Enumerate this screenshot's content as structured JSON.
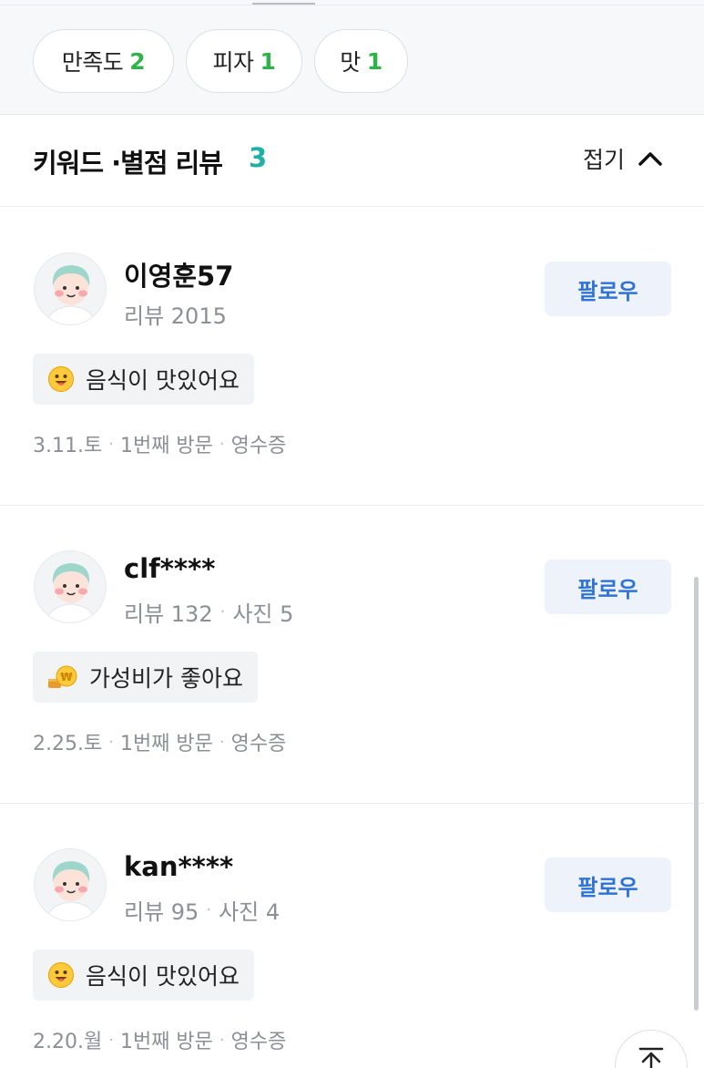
{
  "filters": [
    {
      "label": "만족도",
      "count": "2"
    },
    {
      "label": "피자",
      "count": "1"
    },
    {
      "label": "맛",
      "count": "1"
    }
  ],
  "section": {
    "title": "키워드 ·별점 리뷰",
    "count": "3",
    "collapse_label": "접기",
    "collapse_icon": "chevron-up-icon"
  },
  "reviews": [
    {
      "username": "이영훈57",
      "review_label": "리뷰 2015",
      "photo_label": "",
      "follow_label": "팔로우",
      "keyword": "음식이 맛있어요",
      "keyword_icon": "smile-emoji-icon",
      "date": "3.11.토",
      "visit": "1번째 방문",
      "receipt": "영수증"
    },
    {
      "username": "clf****",
      "review_label": "리뷰 132",
      "photo_label": "사진 5",
      "follow_label": "팔로우",
      "keyword": "가성비가 좋아요",
      "keyword_icon": "coin-icon",
      "date": "2.25.토",
      "visit": "1번째 방문",
      "receipt": "영수증"
    },
    {
      "username": "kan****",
      "review_label": "리뷰 95",
      "photo_label": "사진 4",
      "follow_label": "팔로우",
      "keyword": "음식이 맛있어요",
      "keyword_icon": "smile-emoji-icon",
      "date": "2.20.월",
      "visit": "1번째 방문",
      "receipt": "영수증"
    }
  ],
  "colors": {
    "accent_green": "#2fb24a",
    "section_count": "#1fb1a4",
    "follow_text": "#2f73d6",
    "follow_bg": "#eef3fb"
  },
  "scroll_top_icon": "arrow-up-icon"
}
